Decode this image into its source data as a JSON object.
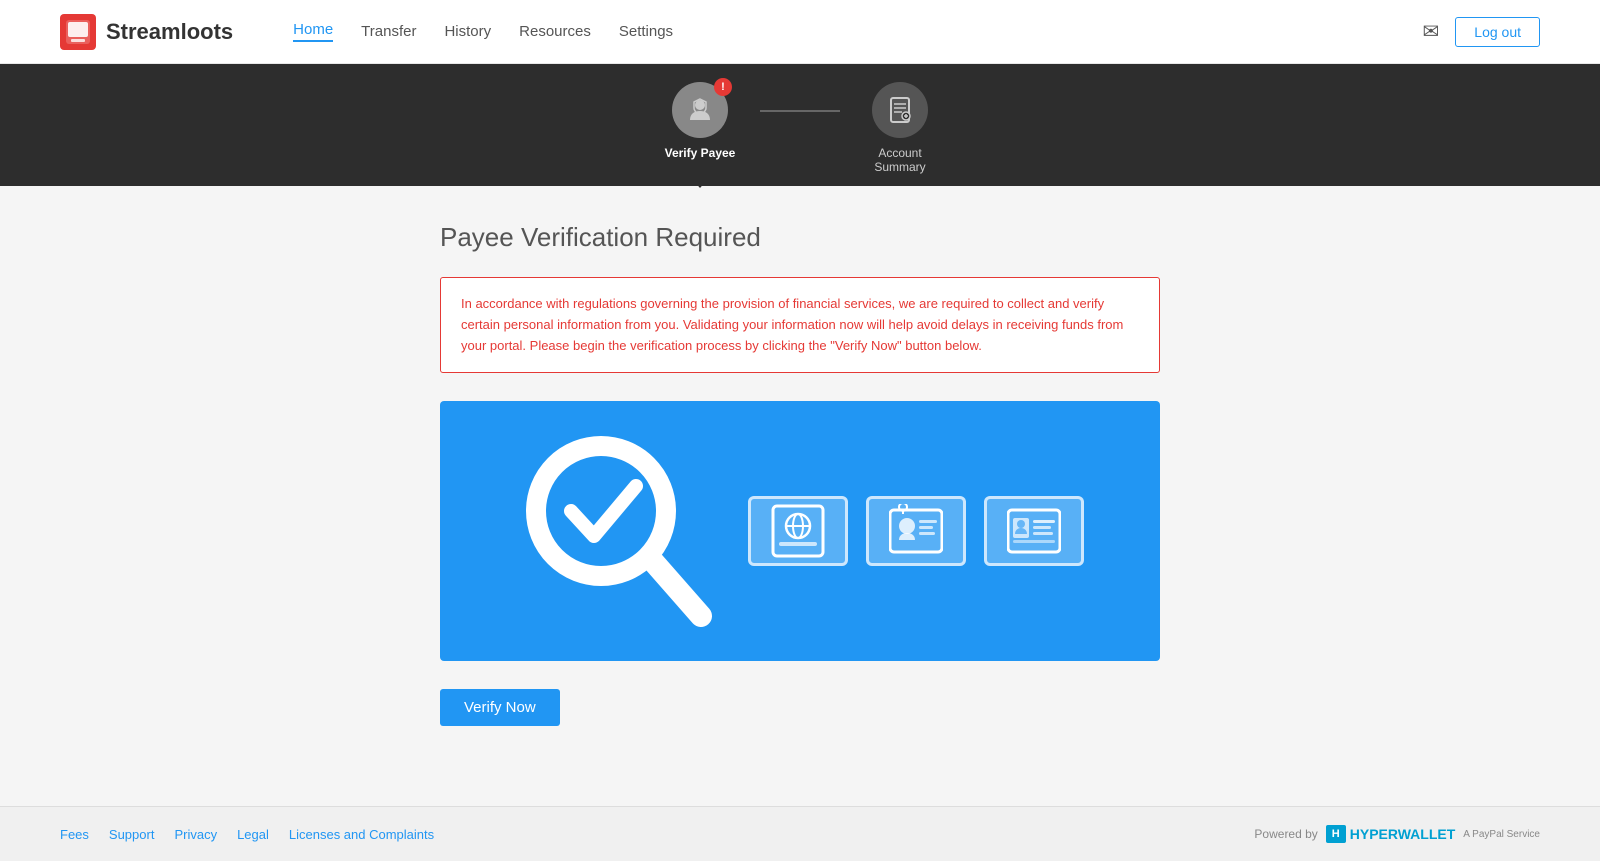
{
  "header": {
    "logo_text": "Streamloots",
    "nav": {
      "home": "Home",
      "transfer": "Transfer",
      "history": "History",
      "resources": "Resources",
      "settings": "Settings"
    },
    "logout_label": "Log out"
  },
  "steps": [
    {
      "id": "verify-payee",
      "label": "Verify Payee",
      "icon": "person",
      "has_alert": true,
      "selected": true
    },
    {
      "id": "account-summary",
      "label1": "Account",
      "label2": "Summary",
      "icon": "doc",
      "has_alert": false,
      "selected": false
    }
  ],
  "main": {
    "page_title": "Payee Verification Required",
    "alert_text": "In accordance with regulations governing the provision of financial services, we are required to collect and verify certain personal information from you. Validating your information now will help avoid delays in receiving funds from your portal. Please begin the verification process by clicking the \"Verify Now\" button below.",
    "verify_button": "Verify Now"
  },
  "footer": {
    "links": [
      {
        "label": "Fees"
      },
      {
        "label": "Support"
      },
      {
        "label": "Privacy"
      },
      {
        "label": "Legal"
      },
      {
        "label": "Licenses and Complaints"
      }
    ],
    "powered_by": "Powered by",
    "hyperwallet": "HYPERWALLET",
    "paypal_service": "A PayPal Service"
  }
}
